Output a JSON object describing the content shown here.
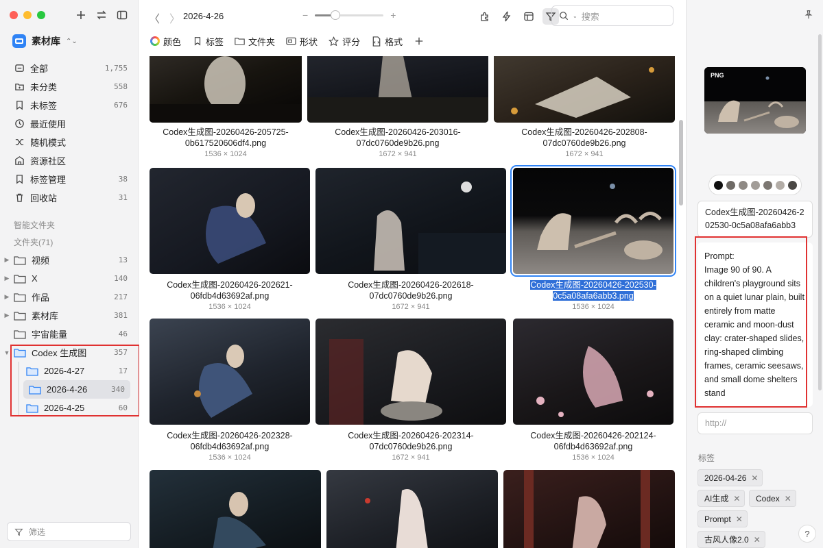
{
  "sidebar": {
    "library": "素材库",
    "nav": [
      {
        "label": "全部",
        "count": "1,755",
        "icon": "stack-icon"
      },
      {
        "label": "未分类",
        "count": "558",
        "icon": "uncategorized-folder-icon"
      },
      {
        "label": "未标签",
        "count": "676",
        "icon": "untagged-icon"
      },
      {
        "label": "最近使用",
        "count": "",
        "icon": "clock-icon"
      },
      {
        "label": "随机模式",
        "count": "",
        "icon": "shuffle-icon"
      },
      {
        "label": "资源社区",
        "count": "",
        "icon": "community-icon"
      },
      {
        "label": "标签管理",
        "count": "38",
        "icon": "bookmark-icon"
      },
      {
        "label": "回收站",
        "count": "31",
        "icon": "trash-icon"
      }
    ],
    "smart_folders_label": "智能文件夹",
    "folders_label": "文件夹(71)",
    "folders": [
      {
        "label": "视频",
        "count": "13"
      },
      {
        "label": "X",
        "count": "140"
      },
      {
        "label": "作品",
        "count": "217"
      },
      {
        "label": "素材库",
        "count": "381"
      },
      {
        "label": "宇宙能量",
        "count": "46"
      },
      {
        "label": "Codex 生成图",
        "count": "357"
      }
    ],
    "subfolders": [
      {
        "label": "2026-4-27",
        "count": "17"
      },
      {
        "label": "2026-4-26",
        "count": "340"
      },
      {
        "label": "2026-4-25",
        "count": "60"
      }
    ],
    "filter_placeholder": "筛选"
  },
  "toolbar": {
    "breadcrumb": "2026-4-26",
    "zoom_level": 0.3,
    "search_placeholder": "搜索",
    "zoom_minus": "−",
    "zoom_plus": "+"
  },
  "filters": [
    {
      "label": "颜色",
      "icon": "color-wheel-icon"
    },
    {
      "label": "标签",
      "icon": "bookmark-icon"
    },
    {
      "label": "文件夹",
      "icon": "folder-icon"
    },
    {
      "label": "形状",
      "icon": "shape-icon"
    },
    {
      "label": "评分",
      "icon": "star-icon"
    },
    {
      "label": "格式",
      "icon": "format-icon"
    }
  ],
  "grid": {
    "items": [
      {
        "name1": "Codex生成图-20260426-205725-",
        "name2": "0b617520606df4.png",
        "dims": "1536 × 1024"
      },
      {
        "name1": "Codex生成图-20260426-203016-",
        "name2": "07dc0760de9b26.png",
        "dims": "1672 × 941"
      },
      {
        "name1": "Codex生成图-20260426-202808-",
        "name2": "07dc0760de9b26.png",
        "dims": "1672 × 941"
      },
      {
        "name1": "Codex生成图-20260426-202621-",
        "name2": "06fdb4d63692af.png",
        "dims": "1536 × 1024"
      },
      {
        "name1": "Codex生成图-20260426-202618-",
        "name2": "07dc0760de9b26.png",
        "dims": "1672 × 941"
      },
      {
        "name1": "Codex生成图-20260426-202530-",
        "name2": "0c5a08afa6abb3.png",
        "dims": "1536 × 1024"
      },
      {
        "name1": "Codex生成图-20260426-202328-",
        "name2": "06fdb4d63692af.png",
        "dims": "1536 × 1024"
      },
      {
        "name1": "Codex生成图-20260426-202314-",
        "name2": "07dc0760de9b26.png",
        "dims": "1672 × 941"
      },
      {
        "name1": "Codex生成图-20260426-202124-",
        "name2": "06fdb4d63692af.png",
        "dims": "1536 × 1024"
      }
    ]
  },
  "inspector": {
    "badge": "PNG",
    "palette": [
      "#111111",
      "#6e6a66",
      "#8f8a85",
      "#a29d98",
      "#7c7772",
      "#b3ada7",
      "#4a4845"
    ],
    "filename": "Codex生成图-20260426-202530-0c5a08afa6abb3",
    "prompt": "Prompt:\nImage 90 of 90. A children's playground sits on a quiet lunar plain, built entirely from matte ceramic and moon-dust clay: crater-shaped slides, ring-shaped climbing frames, ceramic seesaws, and small dome shelters stand",
    "url_placeholder": "http://",
    "tags_label": "标签",
    "tags": [
      "2026-04-26",
      "AI生成",
      "Codex",
      "Prompt",
      "古风人像2.0"
    ]
  },
  "colors": {
    "accent": "#2f83f5",
    "highlight_box": "#e03131"
  }
}
